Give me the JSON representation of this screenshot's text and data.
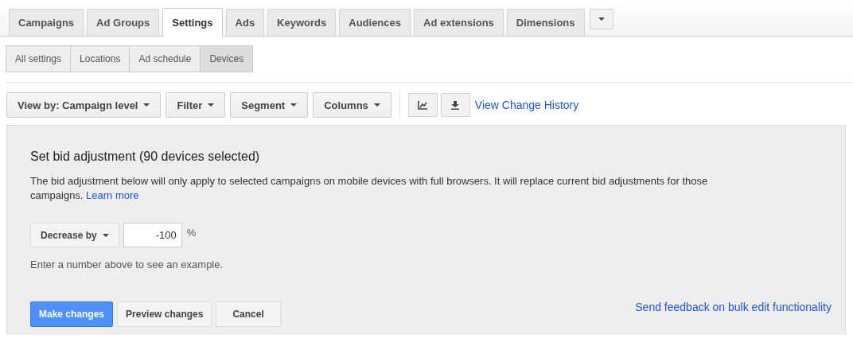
{
  "tabs": [
    {
      "label": "Campaigns",
      "selected": false
    },
    {
      "label": "Ad Groups",
      "selected": false
    },
    {
      "label": "Settings",
      "selected": true
    },
    {
      "label": "Ads",
      "selected": false
    },
    {
      "label": "Keywords",
      "selected": false
    },
    {
      "label": "Audiences",
      "selected": false
    },
    {
      "label": "Ad extensions",
      "selected": false
    },
    {
      "label": "Dimensions",
      "selected": false
    }
  ],
  "subtabs": [
    {
      "label": "All settings",
      "selected": false
    },
    {
      "label": "Locations",
      "selected": false
    },
    {
      "label": "Ad schedule",
      "selected": false
    },
    {
      "label": "Devices",
      "selected": true
    }
  ],
  "toolbar": {
    "menus": [
      "View by: Campaign level",
      "Filter",
      "Segment",
      "Columns"
    ],
    "link": "View Change History"
  },
  "panel": {
    "title": "Set bid adjustment (90 devices selected)",
    "description": "The bid adjustment below will only apply to selected campaigns on mobile devices with full browsers. It will replace current bid adjustments for those campaigns.",
    "learn_more": "Learn more",
    "adjustment": {
      "mode": "Decrease by",
      "value": "-100",
      "unit": "%"
    },
    "hint": "Enter a number above to see an example.",
    "buttons": [
      {
        "label": "Make changes",
        "kind": "primary"
      },
      {
        "label": "Preview changes",
        "kind": "default"
      },
      {
        "label": "Cancel",
        "kind": "default"
      }
    ],
    "feedback": "Send feedback on bulk edit functionality"
  }
}
